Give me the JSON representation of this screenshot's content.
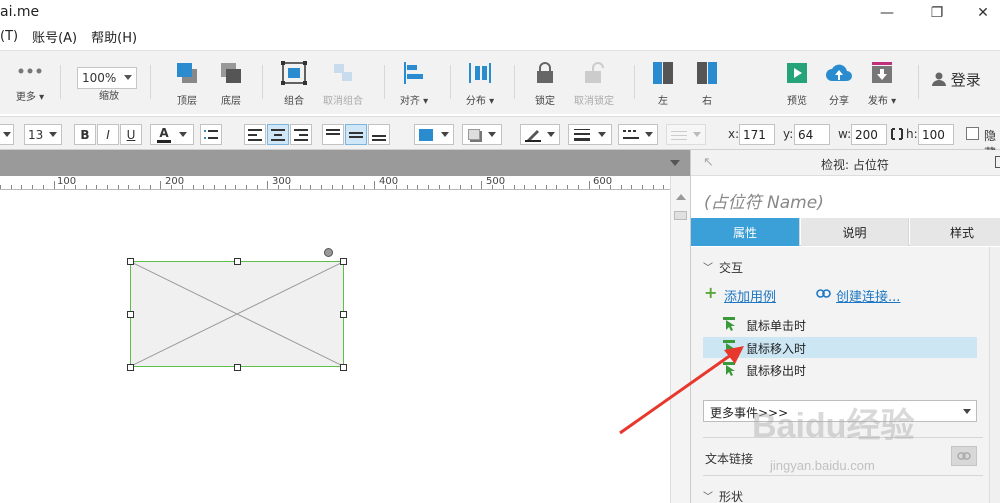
{
  "window": {
    "title": "ai.me",
    "controls": {
      "minimize": "—",
      "restore": "❐",
      "close": "✕"
    }
  },
  "menu": [
    "(T)",
    "账号(A)",
    "帮助(H)"
  ],
  "toolbar": {
    "more": "更多 ▾",
    "zoom_label": "缩放",
    "zoom_value": "100%",
    "top_layer": "顶层",
    "bottom_layer": "底层",
    "group": "组合",
    "ungroup": "取消组合",
    "align": "对齐 ▾",
    "distribute": "分布 ▾",
    "lock": "锁定",
    "unlock": "取消锁定",
    "left": "左",
    "right": "右",
    "preview": "预览",
    "share": "分享",
    "publish": "发布 ▾",
    "login": "登录"
  },
  "format_bar": {
    "font_size": "13",
    "bold": "B",
    "italic": "I",
    "underline": "U",
    "font_color_glyph": "A",
    "x_label": "x:",
    "x_value": "171",
    "y_label": "y:",
    "y_value": "64",
    "w_label": "w:",
    "w_value": "200",
    "h_label": "h:",
    "h_value": "100",
    "hide_label": "隐藏"
  },
  "ruler": [
    "100",
    "200",
    "300",
    "400",
    "500",
    "600"
  ],
  "panel": {
    "title": "检视: 占位符",
    "name_placeholder": "(占位符 Name)",
    "tabs": [
      "属性",
      "说明",
      "样式"
    ],
    "interaction_title": "交互",
    "add_case": "添加用例",
    "create_link": "创建连接...",
    "events": [
      "鼠标单击时",
      "鼠标移入时",
      "鼠标移出时"
    ],
    "more_events": "更多事件>>>",
    "text_link": "文本链接",
    "shape_title": "形状"
  },
  "colors": {
    "accent": "#3b9fd8",
    "selection": "#5dbf4a",
    "arrow": "#e8372c"
  },
  "watermark": {
    "main": "Baidu经验",
    "sub": "jingyan.baidu.com"
  }
}
